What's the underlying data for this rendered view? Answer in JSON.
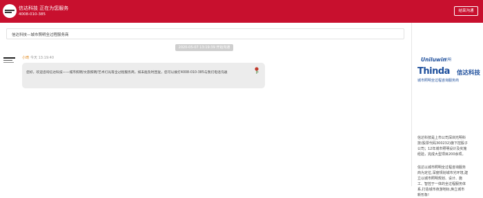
{
  "header": {
    "title": "信达科技 正在为您服务",
    "phone": "4008-010-385",
    "end_button": "结束沟通",
    "brand_color": "#c8102e"
  },
  "chat": {
    "topic": "信达科技—城市照明全过程服务商",
    "session_start": "2020-05-07 13:19:39 开始沟通",
    "message": {
      "sender": "小琦",
      "time": "今天 13:19:40",
      "text": "您好，欢迎咨询信达科技——城市照明/文旅照明/艺术灯光等全过程服务商，如未能及时回复，您可以拨打4008-010-385与我们电话沟通",
      "emoji_icon": "rose-icon"
    }
  },
  "sidebar": {
    "brand_uniluwin": "Uniluwin",
    "brand_uniluwin_sub": "光明",
    "brand_thinda": "Thinda",
    "brand_thinda_cn": "信达科技",
    "tagline": "城市照明全过程咨询服务商",
    "description_1": [
      "信达科技是上市公司深圳光明科",
      "技(股票代码300232)旗下控股子",
      "公司；12年城市照明设计及实施",
      "经验，完成大型项目200余项。"
    ],
    "description_2": [
      "信达以城市照明全过程咨询服务",
      "商为定位,深度规划城市光环境,建",
      "立以城市照明规划、设计、施",
      "工、智控于一体的全过程服务体",
      "系,打造城市夜游地标,焕立城市",
      "新形象!"
    ]
  }
}
